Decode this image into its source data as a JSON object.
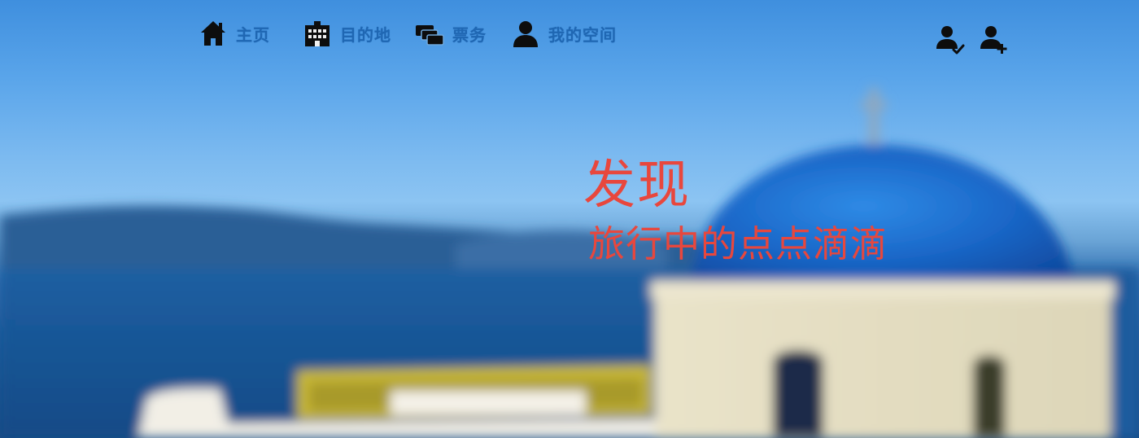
{
  "nav": {
    "items": [
      {
        "label": "主页",
        "icon": "home-icon"
      },
      {
        "label": "目的地",
        "icon": "building-icon"
      },
      {
        "label": "票务",
        "icon": "tickets-icon"
      },
      {
        "label": "我的空间",
        "icon": "user-icon"
      }
    ],
    "label_color": "#1f67b3",
    "account": [
      {
        "icon": "user-check-icon"
      },
      {
        "icon": "user-plus-icon"
      }
    ]
  },
  "hero": {
    "title": "发现",
    "subtitle": "旅行中的点点滴滴",
    "text_color": "#e8473d"
  }
}
